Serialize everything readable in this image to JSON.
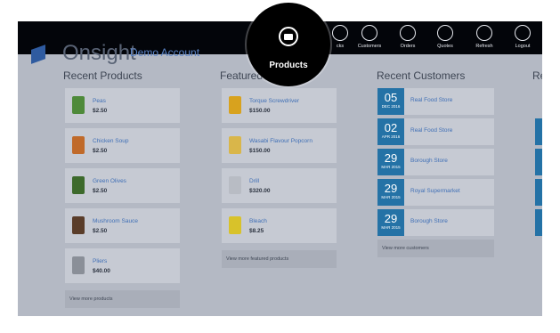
{
  "app": {
    "brand": "Onsight",
    "brand_sub": "Demo Account"
  },
  "nav": {
    "items": [
      {
        "label": "cks",
        "icon": "stocks-icon"
      },
      {
        "label": "Customers",
        "icon": "customers-icon"
      },
      {
        "label": "Orders",
        "icon": "orders-icon"
      },
      {
        "label": "Quotes",
        "icon": "quotes-icon"
      },
      {
        "label": "Refresh",
        "icon": "refresh-icon"
      },
      {
        "label": "Logout",
        "icon": "logout-icon"
      }
    ],
    "highlight": {
      "label": "Products",
      "icon": "folder-icon"
    }
  },
  "recent_products": {
    "title": "Recent Products",
    "items": [
      {
        "name": "Peas",
        "price": "$2.50",
        "color": "#4e8a3a"
      },
      {
        "name": "Chicken Soup",
        "price": "$2.50",
        "color": "#c06a2a"
      },
      {
        "name": "Green Olives",
        "price": "$2.50",
        "color": "#3d6a2c"
      },
      {
        "name": "Mushroom Sauce",
        "price": "$2.50",
        "color": "#5a3d2a"
      },
      {
        "name": "Pliers",
        "price": "$40.00",
        "color": "#8a8f98"
      }
    ],
    "more": "View more products"
  },
  "featured_products": {
    "title": "Featured",
    "items": [
      {
        "name": "Torque Screwdriver",
        "price": "$150.00",
        "color": "#d8a21e"
      },
      {
        "name": "Wasabi Flavour Popcorn",
        "price": "$150.00",
        "color": "#d9b64a"
      },
      {
        "name": "Drill",
        "price": "$320.00",
        "color": "#b8bcc4"
      },
      {
        "name": "Bleach",
        "price": "$8.25",
        "color": "#d8c22a"
      }
    ],
    "more": "View more featured products"
  },
  "recent_customers": {
    "title": "Recent Customers",
    "items": [
      {
        "day": "05",
        "month": "DEC 2016",
        "name": "Real Food Store"
      },
      {
        "day": "02",
        "month": "APR 2016",
        "name": "Real Food Store"
      },
      {
        "day": "29",
        "month": "MAR 2015",
        "name": "Borough Store"
      },
      {
        "day": "29",
        "month": "MAR 2015",
        "name": "Royal Supermarket"
      },
      {
        "day": "29",
        "month": "MAR 2015",
        "name": "Borough Store"
      }
    ],
    "more": "View more customers"
  },
  "fourth_column": {
    "title": "Re"
  }
}
